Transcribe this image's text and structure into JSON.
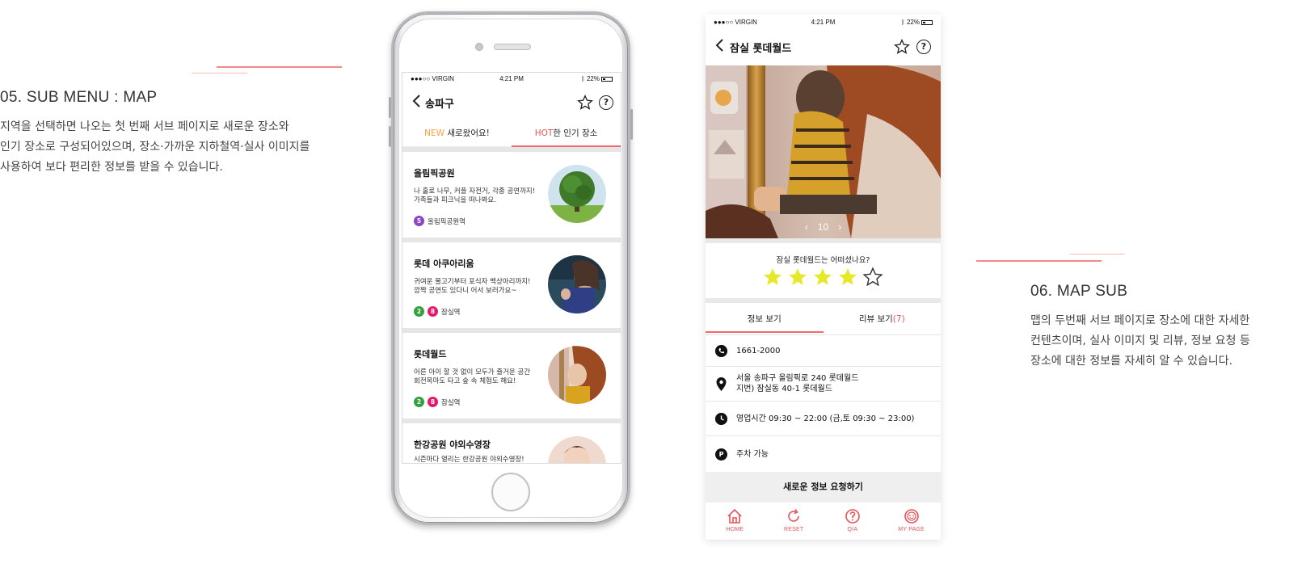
{
  "colors": {
    "accent": "#ee6b6e",
    "hot": "#e8525a",
    "new": "#f3a23b",
    "star": "#e6e829",
    "line2": "#33a23d",
    "line5": "#8e44c7",
    "line8": "#e6186c"
  },
  "section_map": {
    "title": "05. SUB MENU : MAP",
    "desc_lines": [
      "지역을 선택하면 나오는 첫 번째 서브 페이지로 새로운 장소와",
      "인기 장소로 구성되어있으며, 장소·가까운 지하철역·실사 이미지를",
      "사용하여 보다 편리한 정보를 받을 수 있습니다."
    ]
  },
  "section_map_sub": {
    "title": "06. MAP SUB",
    "desc_lines": [
      "맵의 두번째 서브 페이지로 장소에 대한 자세한",
      "컨텐츠이며, 실사 이미지 및 리뷰, 정보 요청 등",
      "장소에 대한 정보를 자세히 알 수 있습니다."
    ]
  },
  "status_bar": {
    "carrier": "●●●○○ VIRGIN",
    "time": "4:21 PM",
    "battery": "22%"
  },
  "screen1": {
    "nav_title": "송파구",
    "icons": {
      "back": "chevron-left-icon",
      "favorite": "star-outline-icon",
      "help": "help-icon"
    },
    "tabs": [
      {
        "highlight": "NEW",
        "label": " 새로왔어요!"
      },
      {
        "highlight": "HOT",
        "label": "한 인기 장소"
      }
    ],
    "cards": [
      {
        "title": "올림픽공원",
        "desc": [
          "나 홀로 나무, 커플 자전거, 각종 공연까지!",
          "가족들과 피크닉을 떠나봐요."
        ],
        "lines": [
          "5"
        ],
        "station": "올림픽공원역"
      },
      {
        "title": "롯데 아쿠아리움",
        "desc": [
          "귀여운 물고기부터 포식자 백상아리까지!",
          "깜짝 공연도 있다니 어서 보러가요~"
        ],
        "lines": [
          "2",
          "8"
        ],
        "station": "잠실역"
      },
      {
        "title": "롯데월드",
        "desc": [
          "어른 아이 할 것 없이 모두가 즐거운 공간",
          "회전목마도 타고 숲 속 체험도 해요!"
        ],
        "lines": [
          "2",
          "8"
        ],
        "station": "잠실역"
      },
      {
        "title": "한강공원 야외수영장",
        "desc": [
          "시즌마다 열리는 한강공원 야외수영장!"
        ],
        "lines": [],
        "station": ""
      }
    ]
  },
  "screen2": {
    "nav_title": "잠실 롯데월드",
    "photo_counter": "10",
    "rating_question": "잠실 롯데월드는 어떠셨나요?",
    "rating": {
      "value": 4,
      "max": 5
    },
    "tabs": {
      "info": "정보 보기",
      "review": "리뷰 보기",
      "review_count": "(7)"
    },
    "info": {
      "phone": "1661-2000",
      "address": [
        "서울 송파구 올림픽로 240 롯데월드",
        "지번) 잠실동 40-1 롯데월드"
      ],
      "hours": "영업시간 09:30 ~ 22:00 (금,토 09:30 ~ 23:00)",
      "parking_icon": "P",
      "parking": "주차 가능"
    },
    "request_button": "새로운 정보 요청하기",
    "bottom_nav": [
      {
        "label": "HOME",
        "icon": "home-icon"
      },
      {
        "label": "RESET",
        "icon": "reset-icon"
      },
      {
        "label": "Q/A",
        "icon": "question-icon"
      },
      {
        "label": "MY PAGE",
        "icon": "smiley-icon"
      }
    ]
  }
}
